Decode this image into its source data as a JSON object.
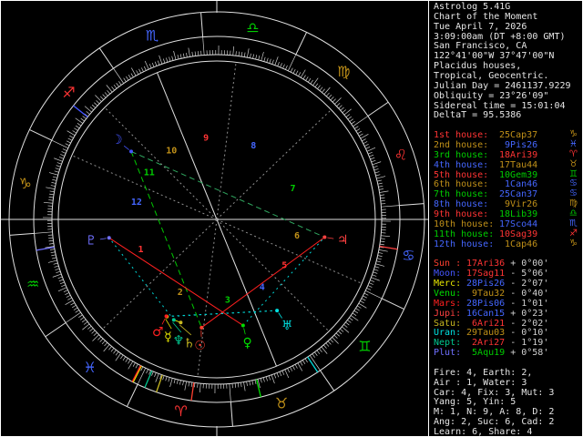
{
  "window": {
    "bg": "#000000",
    "border_color": "#ffffff"
  },
  "palette": {
    "text": "#e6e6e6",
    "dim_text": "#d0d0d0",
    "wheel_line": "#e0e0e0",
    "tick": "#cccccc",
    "cusp_gray": "#909090",
    "fire": "#ff3434",
    "earth": "#c09018",
    "air": "#00cc00",
    "water": "#4466ff"
  },
  "sidebar": {
    "header_lines": [
      "Astrolog 5.41G",
      "Chart of the Moment",
      "Tue April 7, 2026",
      "3:09:00am (DT +8:00 GMT)",
      "San Francisco, CA",
      "122°41'00\"W 37°47'00\"N",
      "Placidus houses,",
      "Tropical, Geocentric.",
      "Julian Day = 2461137.9229",
      "Obliquity = 23°26'09\"",
      "Sidereal time = 15:01:04",
      "DeltaT = 95.5386"
    ],
    "houses": [
      {
        "label": "1st house:",
        "position": "25Cap37",
        "sign_glyph": "♑",
        "sign_element": "earth"
      },
      {
        "label": "2nd house:",
        "position": " 9Pis26",
        "sign_glyph": "♓",
        "sign_element": "water"
      },
      {
        "label": "3rd house:",
        "position": "18Ari39",
        "sign_glyph": "♈",
        "sign_element": "fire"
      },
      {
        "label": "4th house:",
        "position": "17Tau44",
        "sign_glyph": "♉",
        "sign_element": "earth"
      },
      {
        "label": "5th house:",
        "position": "10Gem39",
        "sign_glyph": "♊",
        "sign_element": "air"
      },
      {
        "label": "6th house:",
        "position": " 1Can46",
        "sign_glyph": "♋",
        "sign_element": "water"
      },
      {
        "label": "7th house:",
        "position": "25Can37",
        "sign_glyph": "♋",
        "sign_element": "water"
      },
      {
        "label": "8th house:",
        "position": " 9Vir26",
        "sign_glyph": "♍",
        "sign_element": "earth"
      },
      {
        "label": "9th house:",
        "position": "18Lib39",
        "sign_glyph": "♎",
        "sign_element": "air"
      },
      {
        "label": "10th house:",
        "position": "17Sco44",
        "sign_glyph": "♏",
        "sign_element": "water"
      },
      {
        "label": "11th house:",
        "position": "10Sag39",
        "sign_glyph": "♐",
        "sign_element": "fire"
      },
      {
        "label": "12th house:",
        "position": " 1Cap46",
        "sign_glyph": "♑",
        "sign_element": "earth"
      }
    ],
    "planets": [
      {
        "label": "Sun :",
        "position": "17Ari36",
        "latitude": "+ 0°00'",
        "sign_element": "fire"
      },
      {
        "label": "Moon:",
        "position": "17Sag11",
        "latitude": "- 5°06'",
        "sign_element": "fire"
      },
      {
        "label": "Merc:",
        "position": "28Pis26",
        "latitude": "- 2°07'",
        "sign_element": "water"
      },
      {
        "label": "Venu:",
        "position": " 9Tau32",
        "latitude": "- 0°40'",
        "sign_element": "earth"
      },
      {
        "label": "Mars:",
        "position": "28Pis06",
        "latitude": "- 1°01'",
        "sign_element": "water"
      },
      {
        "label": "Jupi:",
        "position": "16Can15",
        "latitude": "+ 0°23'",
        "sign_element": "water"
      },
      {
        "label": "Satu:",
        "position": " 6Ari21",
        "latitude": "- 2°02'",
        "sign_element": "fire"
      },
      {
        "label": "Uran:",
        "position": "29Tau03",
        "latitude": "- 0°10'",
        "sign_element": "earth"
      },
      {
        "label": "Nept:",
        "position": " 2Ari27",
        "latitude": "- 1°19'",
        "sign_element": "fire"
      },
      {
        "label": "Plut:",
        "position": " 5Aqu19",
        "latitude": "+ 0°58'",
        "sign_element": "air"
      }
    ],
    "summary_lines": [
      "Fire: 4, Earth: 2,",
      "Air : 1, Water: 3",
      "Car: 4, Fix: 3, Mut: 3",
      "Yang: 5, Yin: 5",
      "M: 1, N: 9, A: 8, D: 2",
      "Ang: 2, Suc: 6, Cad: 2",
      "Learn: 6, Share: 4"
    ]
  },
  "wheel": {
    "asc_lon": 295.617,
    "signs": [
      {
        "name": "Aries",
        "glyph": "♈",
        "element": "fire"
      },
      {
        "name": "Taurus",
        "glyph": "♉",
        "element": "earth"
      },
      {
        "name": "Gemini",
        "glyph": "♊",
        "element": "air"
      },
      {
        "name": "Cancer",
        "glyph": "♋",
        "element": "water"
      },
      {
        "name": "Leo",
        "glyph": "♌",
        "element": "fire"
      },
      {
        "name": "Virgo",
        "glyph": "♍",
        "element": "earth"
      },
      {
        "name": "Libra",
        "glyph": "♎",
        "element": "air"
      },
      {
        "name": "Scorpio",
        "glyph": "♏",
        "element": "water"
      },
      {
        "name": "Sagittarius",
        "glyph": "♐",
        "element": "fire"
      },
      {
        "name": "Capricorn",
        "glyph": "♑",
        "element": "earth"
      },
      {
        "name": "Aquarius",
        "glyph": "♒",
        "element": "air"
      },
      {
        "name": "Pisces",
        "glyph": "♓",
        "element": "water"
      }
    ],
    "house_cusps_lon": [
      295.617,
      339.433,
      18.65,
      47.733,
      70.65,
      91.767,
      115.617,
      159.433,
      198.65,
      227.733,
      250.65,
      271.767
    ],
    "planets": [
      {
        "name": "Sun",
        "glyph": "☉",
        "lon": 17.6,
        "color": "#ff4030"
      },
      {
        "name": "Moon",
        "glyph": "☽",
        "lon": 257.183,
        "color": "#4455ff"
      },
      {
        "name": "Mercury",
        "glyph": "☿",
        "lon": 358.433,
        "color": "#e8e800"
      },
      {
        "name": "Venus",
        "glyph": "♀",
        "lon": 39.533,
        "color": "#00dd00"
      },
      {
        "name": "Mars",
        "glyph": "♂",
        "lon": 358.1,
        "color": "#ff2020"
      },
      {
        "name": "Jupiter",
        "glyph": "♃",
        "lon": 106.25,
        "color": "#ff4040"
      },
      {
        "name": "Saturn",
        "glyph": "♄",
        "lon": 6.35,
        "color": "#c8b820"
      },
      {
        "name": "Uranus",
        "glyph": "♅",
        "lon": 59.05,
        "color": "#00e0e0"
      },
      {
        "name": "Neptune",
        "glyph": "♆",
        "lon": 2.45,
        "color": "#00c890"
      },
      {
        "name": "Pluto",
        "glyph": "♇",
        "lon": 305.317,
        "color": "#7070ff"
      }
    ],
    "aspects": [
      {
        "a": "Moon",
        "b": "Sun",
        "type": "trine",
        "color": "#00cc00",
        "dash": "6 4"
      },
      {
        "a": "Moon",
        "b": "Jupiter",
        "type": "quincunx",
        "color": "#30a860",
        "dash": "6 4"
      },
      {
        "a": "Sun",
        "b": "Jupiter",
        "type": "square",
        "color": "#ff2020",
        "dash": ""
      },
      {
        "a": "Venus",
        "b": "Pluto",
        "type": "square",
        "color": "#ff2020",
        "dash": ""
      },
      {
        "a": "Mercury",
        "b": "Uranus",
        "type": "sextile",
        "color": "#00d8d8",
        "dash": "2 4"
      },
      {
        "a": "Mars",
        "b": "Uranus",
        "type": "sextile",
        "color": "#00d8d8",
        "dash": "2 4"
      },
      {
        "a": "Venus",
        "b": "Jupiter",
        "type": "sextile",
        "color": "#00d8d8",
        "dash": "2 4"
      },
      {
        "a": "Neptune",
        "b": "Pluto",
        "type": "sextile",
        "color": "#00d8d8",
        "dash": "2 4"
      },
      {
        "a": "Saturn",
        "b": "Neptune",
        "type": "conjunction",
        "color": "#e8e800",
        "dash": ""
      }
    ]
  }
}
